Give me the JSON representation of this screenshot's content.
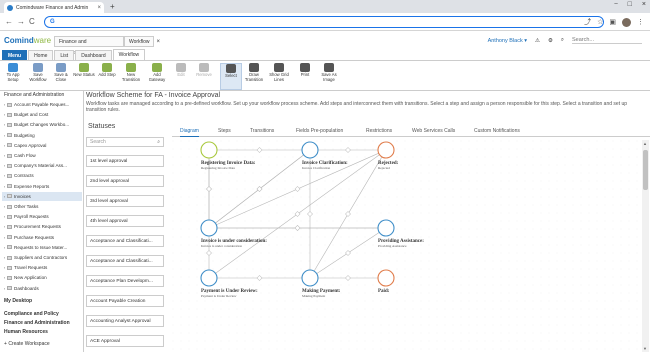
{
  "browser": {
    "tab_title": "Comindware Finance and Admin",
    "tab_close": "×",
    "new_tab": "+",
    "omnibox_text": "G",
    "window_controls": [
      "–",
      "□",
      "×"
    ],
    "back": "←",
    "forward": "→",
    "reload": "C"
  },
  "app": {
    "logo_a": "Comind",
    "logo_b": "ware",
    "breadcrumbs": [
      "Finance and Administration",
      "Workflow"
    ],
    "breadcrumb_close": "×",
    "user": "Anthony Black",
    "user_caret": "▾",
    "search_placeholder": "Search..."
  },
  "menu_tabs": [
    "Menu",
    "Home",
    "List",
    "Dashboard",
    "Workflow"
  ],
  "ribbon": [
    {
      "label": "To App Setup",
      "color": "#3c8dd6",
      "icon": "arrow-left-icon"
    },
    {
      "label": "Save Workflow",
      "color": "#7a9cc6",
      "icon": "save-icon"
    },
    {
      "label": "Save & Close",
      "color": "#7a9cc6",
      "icon": "save-close-icon"
    },
    {
      "label": "New Status",
      "color": "#8ab04a",
      "icon": "new-status-icon"
    },
    {
      "label": "Add Step",
      "color": "#8ab04a",
      "icon": "add-step-icon"
    },
    {
      "label": "New Transition",
      "color": "#8ab04a",
      "icon": "new-transition-icon"
    },
    {
      "label": "Add Gateway",
      "color": "#8ab04a",
      "icon": "add-gateway-icon"
    },
    {
      "label": "Edit",
      "color": "#bbbbbb",
      "icon": "edit-icon"
    },
    {
      "label": "Remove",
      "color": "#bbbbbb",
      "icon": "remove-icon"
    },
    {
      "label": "Select",
      "color": "#555555",
      "icon": "select-icon"
    },
    {
      "label": "Draw Transition",
      "color": "#555555",
      "icon": "draw-transition-icon"
    },
    {
      "label": "Show Grid Lines",
      "color": "#555555",
      "icon": "grid-icon"
    },
    {
      "label": "Print",
      "color": "#555555",
      "icon": "print-icon"
    },
    {
      "label": "Save As Image",
      "color": "#555555",
      "icon": "image-icon"
    }
  ],
  "sidebar": {
    "group_title": "Finance and Administration",
    "items": [
      "Account Payable Reques...",
      "Budget and Cost",
      "Budget Changes Workbo...",
      "Budgeting",
      "Capex Approval",
      "Cash Flow",
      "Company's Material Ass...",
      "Contracts",
      "Expense Reports",
      "Invoices",
      "Other Tasks",
      "Payroll Requests",
      "Procurement Requests",
      "Purchase Requests",
      "Requests to Issue Mater...",
      "Suppliers and Contractors",
      "Travel Requests",
      "New Application",
      "Dashboards"
    ],
    "sections": [
      "My Desktop",
      "Compliance and Policy",
      "Finance and Administration",
      "Human Resources",
      "Create Workspace"
    ]
  },
  "main": {
    "title": "Workflow Scheme for FA - Invoice Approval",
    "description": "Workflow tasks are managed according to a pre-defined workflow. Set up your workflow process scheme. Add steps and interconnect them with transitions. Select a step and assign a person responsible for this step. Select a transition and set up transition rules."
  },
  "statuses": {
    "header": "Statuses",
    "search_placeholder": "Search",
    "search_icon": "⌕",
    "items": [
      "1st level approval",
      "2nd level approval",
      "3rd level approval",
      "4th level approval",
      "Acceptance and Classificati...",
      "Acceptance and Classificati...",
      "Acceptance Plan Developm...",
      "Account Payable Creation",
      "Accounting Analyst Approval",
      "ACE Approval",
      "ACE Stage Approval"
    ]
  },
  "diagram_tabs": [
    "Diagram",
    "Steps",
    "Transitions",
    "Fields Pre-population",
    "Restrictions",
    "Web Services Calls",
    "Custom Notifications"
  ],
  "diagram": {
    "colors": {
      "start": "#a8c83c",
      "step": "#3f8ec8",
      "end": "#e07c4a",
      "line": "#b8b8b8"
    },
    "nodes": [
      {
        "id": "n1",
        "name": "Registering Invoice Data:",
        "sub": "Registering Invoice Data",
        "kind": "start"
      },
      {
        "id": "n2",
        "name": "Invoice Clarification:",
        "sub": "Invoice Clarification",
        "kind": "step"
      },
      {
        "id": "n3",
        "name": "Rejected:",
        "sub": "Rejected",
        "kind": "end"
      },
      {
        "id": "n4",
        "name": "Invoice is under consideration:",
        "sub": "Invoice is under consideration",
        "kind": "step"
      },
      {
        "id": "n5",
        "name": "Providing Assistance:",
        "sub": "Providing Assistance",
        "kind": "step"
      },
      {
        "id": "n6",
        "name": "Payment is Under Review:",
        "sub": "Payment is Under Review",
        "kind": "step"
      },
      {
        "id": "n7",
        "name": "Making Payment:",
        "sub": "Making Payment",
        "kind": "step"
      },
      {
        "id": "n8",
        "name": "Paid:",
        "sub": "",
        "kind": "end"
      }
    ],
    "edges": [
      [
        "n1",
        "n4"
      ],
      [
        "n4",
        "n1"
      ],
      [
        "n1",
        "n2"
      ],
      [
        "n2",
        "n4"
      ],
      [
        "n4",
        "n2"
      ],
      [
        "n2",
        "n3"
      ],
      [
        "n4",
        "n3"
      ],
      [
        "n4",
        "n5"
      ],
      [
        "n5",
        "n4"
      ],
      [
        "n4",
        "n6"
      ],
      [
        "n6",
        "n7"
      ],
      [
        "n7",
        "n8"
      ],
      [
        "n2",
        "n7"
      ],
      [
        "n6",
        "n3"
      ],
      [
        "n5",
        "n7"
      ],
      [
        "n7",
        "n3"
      ]
    ]
  }
}
